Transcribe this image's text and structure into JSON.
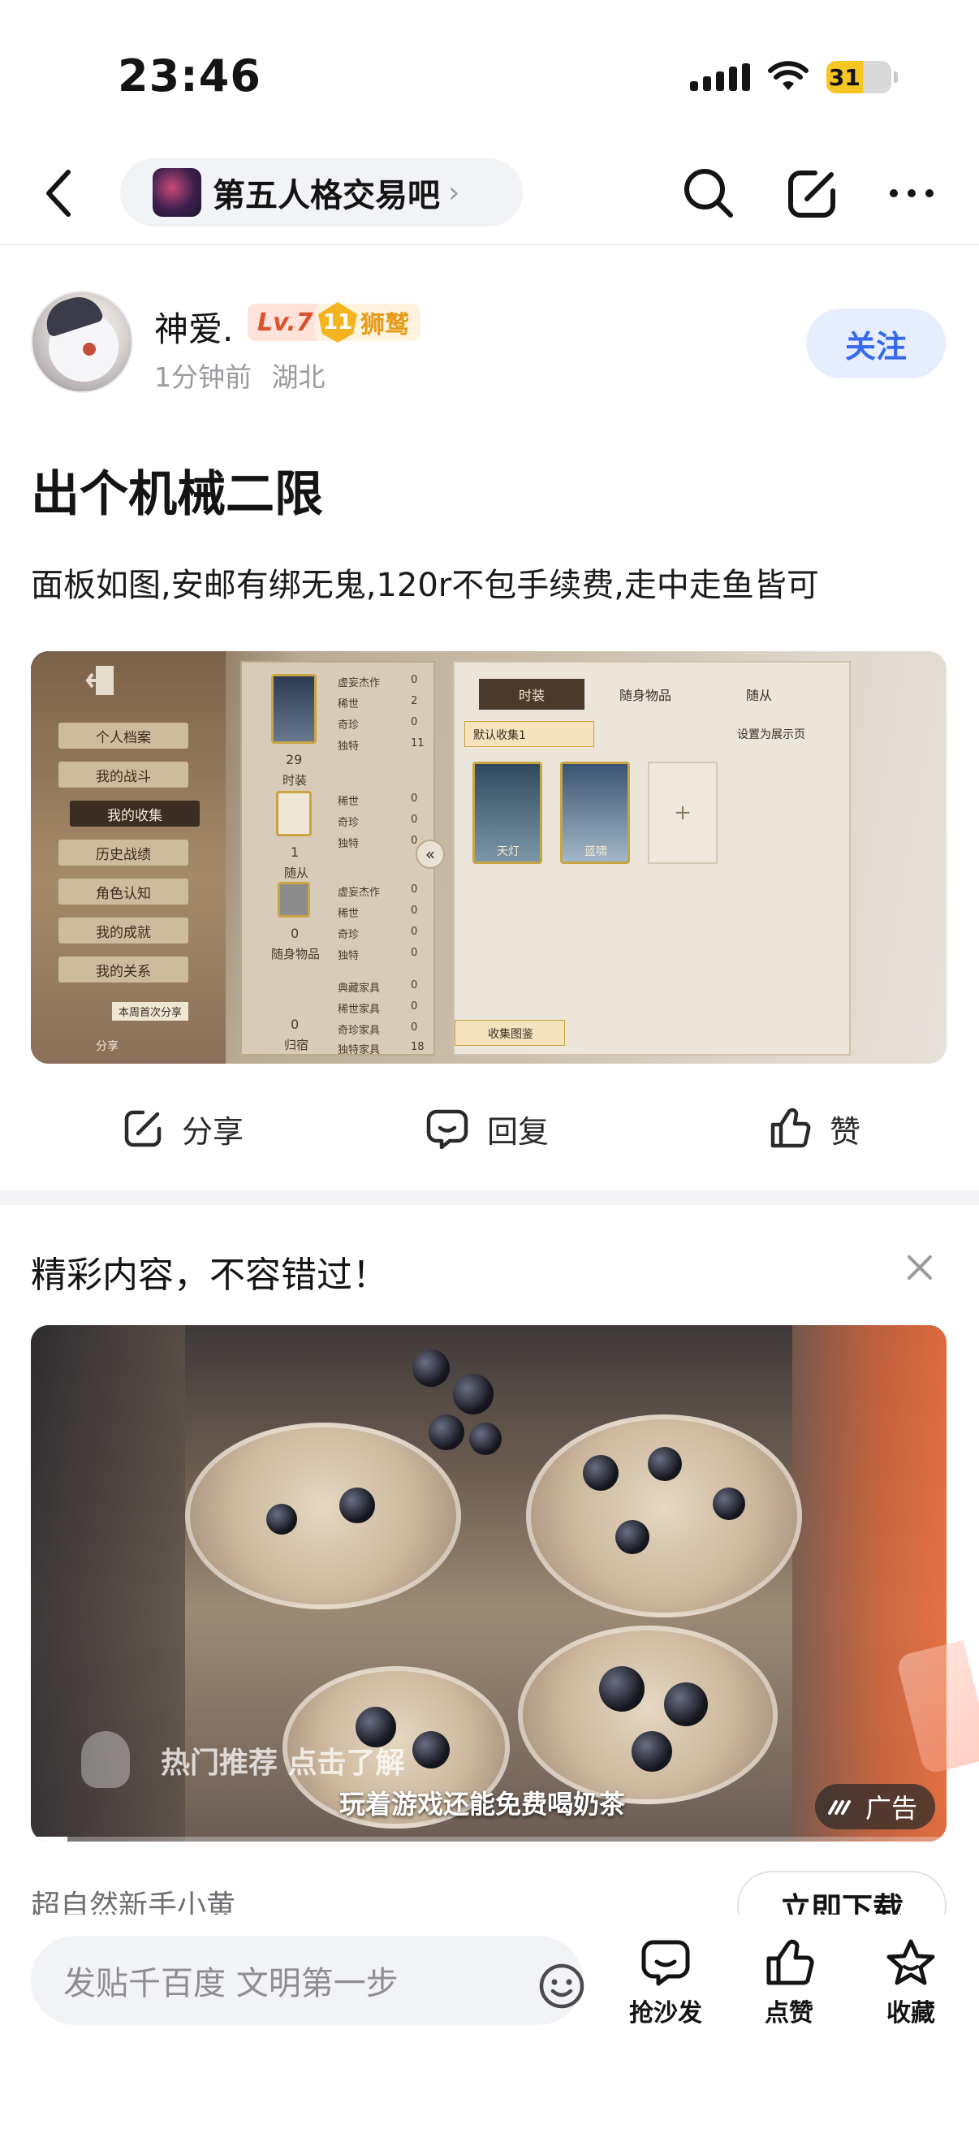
{
  "status_bar": {
    "time": "23:46",
    "battery": "31"
  },
  "nav": {
    "forum_name": "第五人格交易吧",
    "chevron": "›"
  },
  "post": {
    "author": "神爱.",
    "level": "Lv.7",
    "honor_level": "11",
    "honor_title": "狮鹫",
    "time": "1分钟前",
    "location": "湖北",
    "follow_label": "关注",
    "title": "出个机械二限",
    "body": "面板如图,安邮有绑无鬼,120r不包手续费,走中走鱼皆可",
    "image": {
      "menu": [
        "个人档案",
        "我的战斗",
        "我的收集",
        "历史战绩",
        "角色认知",
        "我的成就",
        "我的关系"
      ],
      "active_menu": "我的收集",
      "share_label": "分享",
      "share_tip": "本周首次分享",
      "stats_costume": [
        [
          "虚妄杰作",
          "0"
        ],
        [
          "稀世",
          "2"
        ],
        [
          "奇珍",
          "0"
        ],
        [
          "独特",
          "11"
        ]
      ],
      "costume_count": "29",
      "costume_label": "时装",
      "stats_follower": [
        [
          "稀世",
          "0"
        ],
        [
          "奇珍",
          "0"
        ],
        [
          "独特",
          "0"
        ]
      ],
      "follower_count": "1",
      "follower_label": "随从",
      "stats_accessory": [
        [
          "虚妄杰作",
          "0"
        ],
        [
          "稀世",
          "0"
        ],
        [
          "奇珍",
          "0"
        ],
        [
          "独特",
          "0"
        ]
      ],
      "accessory_count": "0",
      "accessory_label": "随身物品",
      "stats_home": [
        [
          "典藏家具",
          "0"
        ],
        [
          "稀世家具",
          "0"
        ],
        [
          "奇珍家具",
          "0"
        ],
        [
          "独特家具",
          "18"
        ]
      ],
      "home_count": "0",
      "home_label": "归宿",
      "tabs": [
        "时装",
        "随身物品",
        "随从"
      ],
      "dropdown": "默认收集1",
      "display_toggle": "设置为展示页",
      "card1": "天灯",
      "card2": "蓝啸",
      "album_label": "收集图鉴"
    }
  },
  "actions": {
    "share": "分享",
    "reply": "回复",
    "like": "赞"
  },
  "recommend": {
    "title": "精彩内容，不容错过！",
    "ad_hint": "热门推荐 点击了解",
    "ad_caption": "玩着游戏还能免费喝奶茶",
    "ad_badge": "广告",
    "advertiser": "超自然新手小黄",
    "download_label": "立即下载"
  },
  "composer": {
    "placeholder": "发贴千百度 文明第一步",
    "sofa_label": "抢沙发",
    "like_label": "点赞",
    "collect_label": "收藏"
  },
  "colors": {
    "accent": "#3469f0",
    "follow_bg": "#e6edff",
    "level_red": "#d9532e",
    "honor_gold": "#e79a16"
  }
}
